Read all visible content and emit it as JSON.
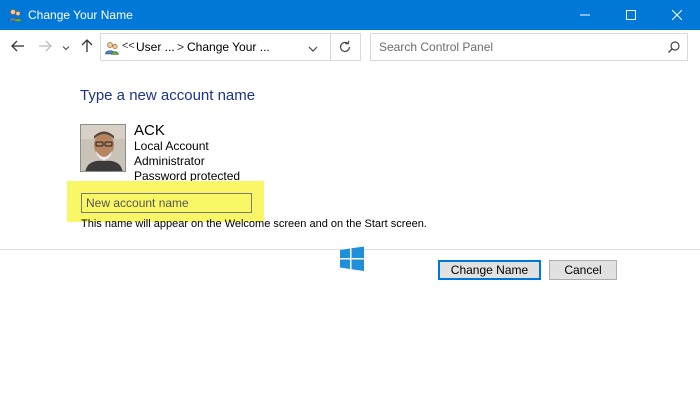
{
  "window": {
    "title": "Change Your Name",
    "app_icon": "users-icon",
    "controls": [
      "minimize-icon",
      "maximize-icon",
      "close-icon"
    ]
  },
  "nav": {
    "back": "back-arrow-icon",
    "forward": "forward-arrow-icon",
    "recent": "chevron-down-icon",
    "up": "up-arrow-icon"
  },
  "address": {
    "prefix": "<<",
    "crumbs": [
      "User ...",
      "Change Your ..."
    ],
    "separator": ">"
  },
  "search": {
    "placeholder": "Search Control Panel"
  },
  "main": {
    "heading": "Type a new account name",
    "account": {
      "name": "ACK",
      "details": [
        "Local Account",
        "Administrator",
        "Password protected"
      ]
    },
    "new_name_field": {
      "value": "",
      "placeholder": "New account name"
    },
    "hint": "This name will appear on the Welcome screen and on the Start screen.",
    "buttons": {
      "primary": "Change Name",
      "secondary": "Cancel"
    }
  },
  "colors": {
    "titlebar": "#0078d7",
    "heading": "#1e3287",
    "highlight": "#f9f765"
  }
}
